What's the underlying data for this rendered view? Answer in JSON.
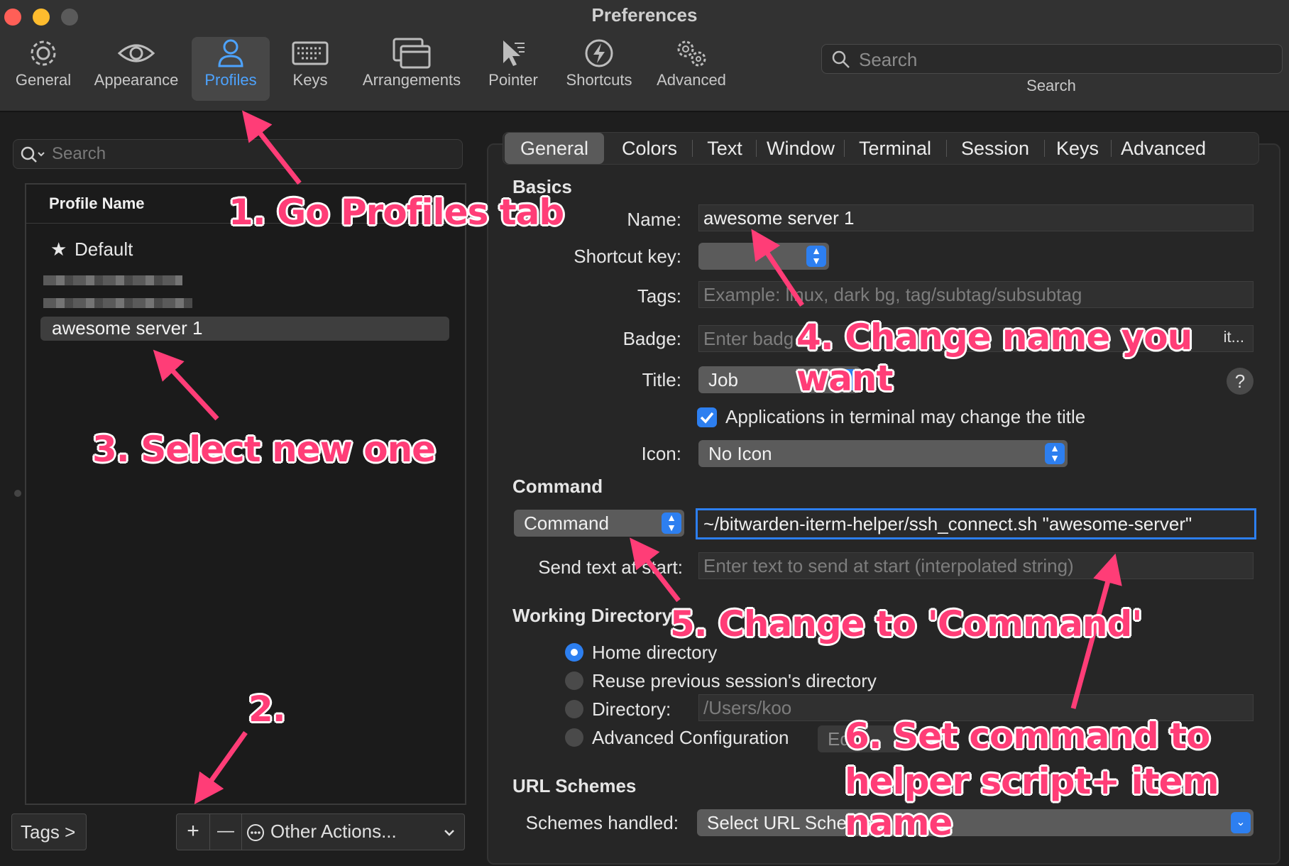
{
  "window": {
    "title": "Preferences",
    "traffic_lights": [
      "close",
      "minimize",
      "zoom"
    ]
  },
  "toolbar": {
    "items": [
      {
        "label": "General",
        "icon": "gear-icon"
      },
      {
        "label": "Appearance",
        "icon": "eye-icon"
      },
      {
        "label": "Profiles",
        "icon": "person-icon",
        "active": true
      },
      {
        "label": "Keys",
        "icon": "keyboard-icon"
      },
      {
        "label": "Arrangements",
        "icon": "windows-icon"
      },
      {
        "label": "Pointer",
        "icon": "pointer-icon"
      },
      {
        "label": "Shortcuts",
        "icon": "bolt-icon"
      },
      {
        "label": "Advanced",
        "icon": "gears-icon"
      }
    ],
    "search_placeholder": "Search",
    "search_caption": "Search"
  },
  "profiles": {
    "search_placeholder": "Search",
    "header": "Profile Name",
    "items": [
      {
        "label": "Default",
        "starred": true
      },
      {
        "label": "awesome server 1",
        "selected": true
      }
    ],
    "tags_button": "Tags >",
    "add_button": "+",
    "remove_button": "—",
    "other_actions": "Other Actions..."
  },
  "tabs": [
    "General",
    "Colors",
    "Text",
    "Window",
    "Terminal",
    "Session",
    "Keys",
    "Advanced"
  ],
  "active_tab": "General",
  "basics": {
    "section": "Basics",
    "name_label": "Name:",
    "name_value": "awesome server 1",
    "shortcut_label": "Shortcut key:",
    "tags_label": "Tags:",
    "tags_placeholder": "Example: linux, dark bg, tag/subtag/subsubtag",
    "badge_label": "Badge:",
    "badge_placeholder": "Enter badg",
    "badge_edit": "it...",
    "title_label": "Title:",
    "title_value": "Job",
    "title_help": "?",
    "apps_change_title": "Applications in terminal may change the title",
    "apps_change_title_checked": true,
    "icon_label": "Icon:",
    "icon_value": "No Icon"
  },
  "command": {
    "section": "Command",
    "type": "Command",
    "value": "~/bitwarden-iterm-helper/ssh_connect.sh \"awesome-server\"",
    "send_text_label": "Send text at start:",
    "send_text_placeholder": "Enter text to send at start (interpolated string)"
  },
  "working_directory": {
    "section": "Working Directory",
    "options": [
      {
        "label": "Home directory",
        "selected": true
      },
      {
        "label": "Reuse previous session's directory",
        "selected": false
      },
      {
        "label": "Directory:",
        "selected": false
      },
      {
        "label": "Advanced Configuration",
        "selected": false
      }
    ],
    "directory_value": "/Users/koo",
    "edit_button": "Ed"
  },
  "url_schemes": {
    "section": "URL Schemes",
    "label": "Schemes handled:",
    "value": "Select URL Schemes..."
  },
  "annotations": {
    "step1": "1. Go Profiles tab",
    "step2": "2.",
    "step3": "3. Select new one",
    "step4": "4. Change name you want",
    "step5": "5. Change to 'Command'",
    "step6_line1": "6. Set command to",
    "step6_line2": "helper script+ item name"
  },
  "colors": {
    "accent": "#2d7ff0",
    "active_tab_text": "#4da3ff",
    "annotation": "#ff3d77"
  }
}
